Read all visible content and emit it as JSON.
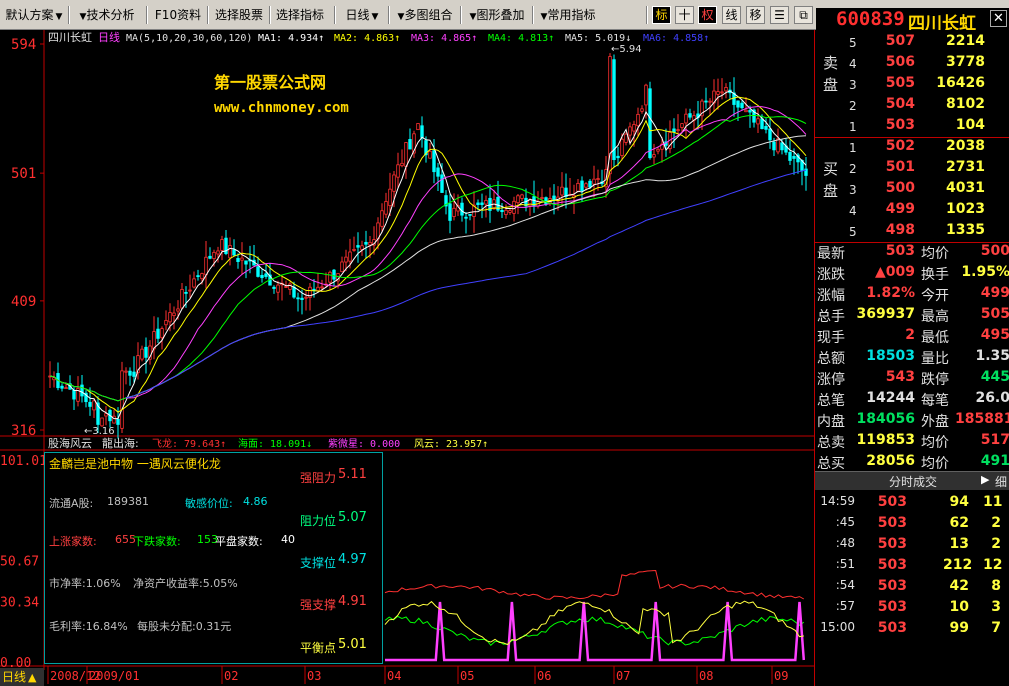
{
  "toolbar": {
    "default_plan": "默认方案",
    "tech_analysis": "技术分析",
    "f10": "F10资料",
    "select_stock": "选择股票",
    "select_indicator": "选择指标",
    "daily": "日线",
    "multi_chart": "多图组合",
    "overlay": "图形叠加",
    "common_indicator": "常用指标",
    "icon_biao": "标",
    "icon_plus": "十",
    "icon_quan": "权",
    "icon_xian": "线",
    "icon_yi": "移"
  },
  "stock": {
    "code": "600839",
    "name": "四川长虹"
  },
  "main_chart": {
    "title_name": "四川长虹",
    "period": "日线",
    "ma_label": "MA(5,10,20,30,60,120)",
    "ma1": "MA1: 4.934↑",
    "ma2": "MA2: 4.863↑",
    "ma3": "MA3: 4.865↑",
    "ma4": "MA4: 4.813↑",
    "ma5": "MA5: 5.019↓",
    "ma6": "MA6: 4.858↑",
    "watermark_1": "第一股票公式网",
    "watermark_2": "www.chnmoney.com",
    "low_annot": "←3.16",
    "high_annot": "←5.94",
    "y_ticks": [
      "594",
      "501",
      "409",
      "316"
    ]
  },
  "sub_chart": {
    "title": "股海风云",
    "series_1": "龍出海:",
    "series_1_sep": "飞龙: 79.643↑",
    "series_2": "海面: 18.091↓",
    "series_3": "紫微星: 0.000",
    "series_4": "风云: 23.957↑",
    "y_ticks": [
      "101.01",
      "50.67",
      "30.34",
      "0.00"
    ]
  },
  "x_axis": [
    "2008/12",
    "2009/01",
    "02",
    "03",
    "04",
    "05",
    "06",
    "07",
    "08",
    "09"
  ],
  "bottom_tab": "日线",
  "info_panel": {
    "title": "金麟岂是池中物 一遇风云便化龙",
    "strong_resist_label": "强阻力",
    "strong_resist_val": "5.11",
    "circ_label": "流通A股:",
    "circ_val": "189381",
    "sens_label": "敏感价位:",
    "sens_val": "4.86",
    "resist_label": "阻力位",
    "resist_val": "5.07",
    "up_label": "上涨家数:",
    "up_val": "655",
    "down_label": "下跌家数:",
    "down_val": "153",
    "flat_label": "平盘家数:",
    "flat_val": "40",
    "support_label": "支撑位",
    "support_val": "4.97",
    "pb": "市净率:1.06%",
    "roe": "净资产收益率:5.05%",
    "strong_support_label": "强支撑",
    "strong_support_val": "4.91",
    "margin": "毛利率:16.84%",
    "undistributed": "每股未分配:0.31元",
    "balance_label": "平衡点",
    "balance_val": "5.01"
  },
  "order_book": {
    "sell_label": "卖盘",
    "buy_label": "买盘",
    "sells": [
      {
        "lvl": "5",
        "price": "507",
        "vol": "2214"
      },
      {
        "lvl": "4",
        "price": "506",
        "vol": "3778"
      },
      {
        "lvl": "3",
        "price": "505",
        "vol": "16426"
      },
      {
        "lvl": "2",
        "price": "504",
        "vol": "8102"
      },
      {
        "lvl": "1",
        "price": "503",
        "vol": "104"
      }
    ],
    "buys": [
      {
        "lvl": "1",
        "price": "502",
        "vol": "2038"
      },
      {
        "lvl": "2",
        "price": "501",
        "vol": "2731"
      },
      {
        "lvl": "3",
        "price": "500",
        "vol": "4031"
      },
      {
        "lvl": "4",
        "price": "499",
        "vol": "1023"
      },
      {
        "lvl": "5",
        "price": "498",
        "vol": "1335"
      }
    ]
  },
  "quote": [
    {
      "k1": "最新",
      "v1": "503",
      "c1": "red",
      "k2": "均价",
      "v2": "500",
      "c2": "red"
    },
    {
      "k1": "涨跌",
      "v1": "▲009",
      "c1": "red",
      "k2": "换手",
      "v2": "1.95%",
      "c2": "yel"
    },
    {
      "k1": "涨幅",
      "v1": "1.82%",
      "c1": "red",
      "k2": "今开",
      "v2": "499",
      "c2": "red"
    },
    {
      "k1": "总手",
      "v1": "369937",
      "c1": "yel",
      "k2": "最高",
      "v2": "505",
      "c2": "red"
    },
    {
      "k1": "现手",
      "v1": "2",
      "c1": "red",
      "k2": "最低",
      "v2": "495",
      "c2": "red"
    },
    {
      "k1": "总额",
      "v1": "18503",
      "c1": "cyn",
      "k2": "量比",
      "v2": "1.35",
      "c2": "wht"
    },
    {
      "k1": "涨停",
      "v1": "543",
      "c1": "red",
      "k2": "跌停",
      "v2": "445",
      "c2": "grn"
    },
    {
      "k1": "总笔",
      "v1": "14244",
      "c1": "wht",
      "k2": "每笔",
      "v2": "26.0",
      "c2": "wht"
    },
    {
      "k1": "内盘",
      "v1": "184056",
      "c1": "grn",
      "k2": "外盘",
      "v2": "185881",
      "c2": "red"
    },
    {
      "k1": "总卖",
      "v1": "119853",
      "c1": "yel",
      "k2": "均价",
      "v2": "517",
      "c2": "red"
    },
    {
      "k1": "总买",
      "v1": "28056",
      "c1": "yel",
      "k2": "均价",
      "v2": "491",
      "c2": "grn"
    }
  ],
  "ticks_header": "分时成交",
  "ticks_tab": "细",
  "ticks": [
    {
      "t": "14:59",
      "p": "503",
      "v": "94",
      "n": "11"
    },
    {
      "t": ":45",
      "p": "503",
      "v": "62",
      "n": "2"
    },
    {
      "t": ":48",
      "p": "503",
      "v": "13",
      "n": "2"
    },
    {
      "t": ":51",
      "p": "503",
      "v": "212",
      "n": "12"
    },
    {
      "t": ":54",
      "p": "503",
      "v": "42",
      "n": "8"
    },
    {
      "t": ":57",
      "p": "503",
      "v": "10",
      "n": "3"
    },
    {
      "t": "15:00",
      "p": "503",
      "v": "99",
      "n": "7"
    }
  ],
  "chart_data": [
    {
      "type": "candlestick",
      "title": "四川长虹 日线",
      "ylim": [
        3.16,
        5.94
      ],
      "y_ticks": [
        5.94,
        5.01,
        4.09,
        3.16
      ],
      "x_categories": [
        "2008/12",
        "2009/01",
        "02",
        "03",
        "04",
        "05",
        "06",
        "07",
        "08",
        "09"
      ],
      "close_by_month": [
        3.45,
        3.6,
        4.5,
        4.1,
        4.6,
        4.75,
        4.85,
        5.1,
        5.6,
        5.0
      ],
      "annotations": {
        "low": 3.16,
        "high": 5.94
      },
      "series": [
        {
          "name": "MA1",
          "last": 4.934,
          "color": "#ffffff"
        },
        {
          "name": "MA2",
          "last": 4.863,
          "color": "#ffff00"
        },
        {
          "name": "MA3",
          "last": 4.865,
          "color": "#ff40ff"
        },
        {
          "name": "MA4",
          "last": 4.813,
          "color": "#00ff00"
        },
        {
          "name": "MA5",
          "last": 5.019,
          "color": "#e0e0e0"
        },
        {
          "name": "MA6",
          "last": 4.858,
          "color": "#4040ff"
        }
      ]
    },
    {
      "type": "line",
      "title": "股海风云",
      "ylim": [
        0,
        101.01
      ],
      "y_ticks": [
        101.01,
        50.67,
        30.34,
        0.0
      ],
      "series": [
        {
          "name": "飞龙",
          "last": 79.643,
          "color": "#ff3030"
        },
        {
          "name": "海面",
          "last": 18.091,
          "color": "#00ff00"
        },
        {
          "name": "紫微星",
          "last": 0.0,
          "color": "#ff40ff"
        },
        {
          "name": "风云",
          "last": 23.957,
          "color": "#ffff40"
        }
      ]
    }
  ]
}
